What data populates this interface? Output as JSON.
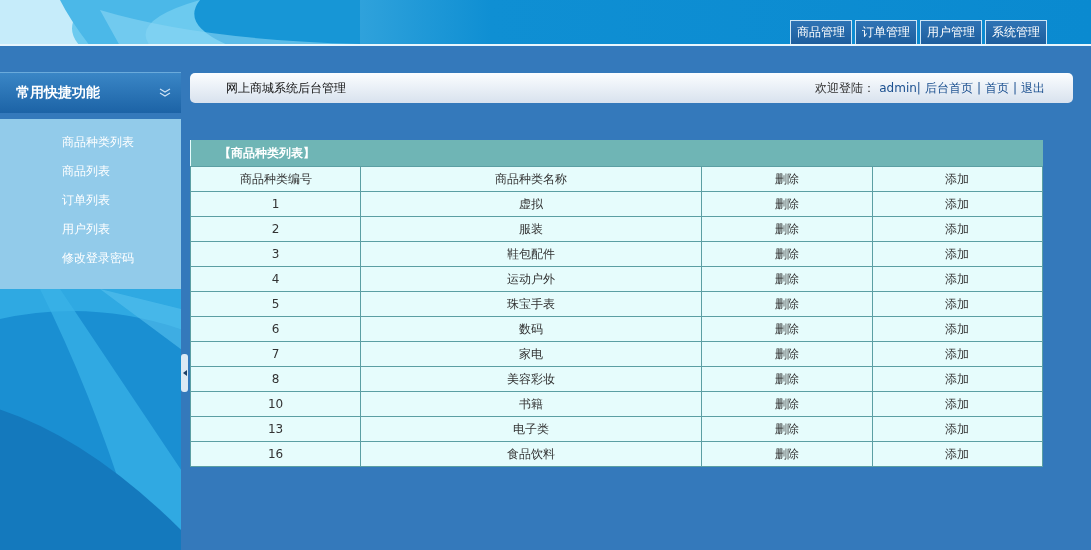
{
  "nav_tabs": [
    {
      "label": "商品管理"
    },
    {
      "label": "订单管理"
    },
    {
      "label": "用户管理"
    },
    {
      "label": "系统管理"
    }
  ],
  "sidebar": {
    "title": "常用快捷功能",
    "items": [
      "商品种类列表",
      "商品列表",
      "订单列表",
      "用户列表",
      "修改登录密码"
    ]
  },
  "header": {
    "title": "网上商城系统后台管理",
    "welcome": "欢迎登陆：",
    "user": "admin|",
    "links": [
      "后台首页",
      "首页",
      "退出"
    ],
    "separator": "|"
  },
  "table": {
    "title": "【商品种类列表】",
    "columns": [
      "商品种类编号",
      "商品种类名称",
      "删除",
      "添加"
    ],
    "rows": [
      [
        "1",
        "虚拟",
        "删除",
        "添加"
      ],
      [
        "2",
        "服装",
        "删除",
        "添加"
      ],
      [
        "3",
        "鞋包配件",
        "删除",
        "添加"
      ],
      [
        "4",
        "运动户外",
        "删除",
        "添加"
      ],
      [
        "5",
        "珠宝手表",
        "删除",
        "添加"
      ],
      [
        "6",
        "数码",
        "删除",
        "添加"
      ],
      [
        "7",
        "家电",
        "删除",
        "添加"
      ],
      [
        "8",
        "美容彩妆",
        "删除",
        "添加"
      ],
      [
        "10",
        "书籍",
        "删除",
        "添加"
      ],
      [
        "13",
        "电子类",
        "删除",
        "添加"
      ],
      [
        "16",
        "食品饮料",
        "删除",
        "添加"
      ]
    ]
  }
}
